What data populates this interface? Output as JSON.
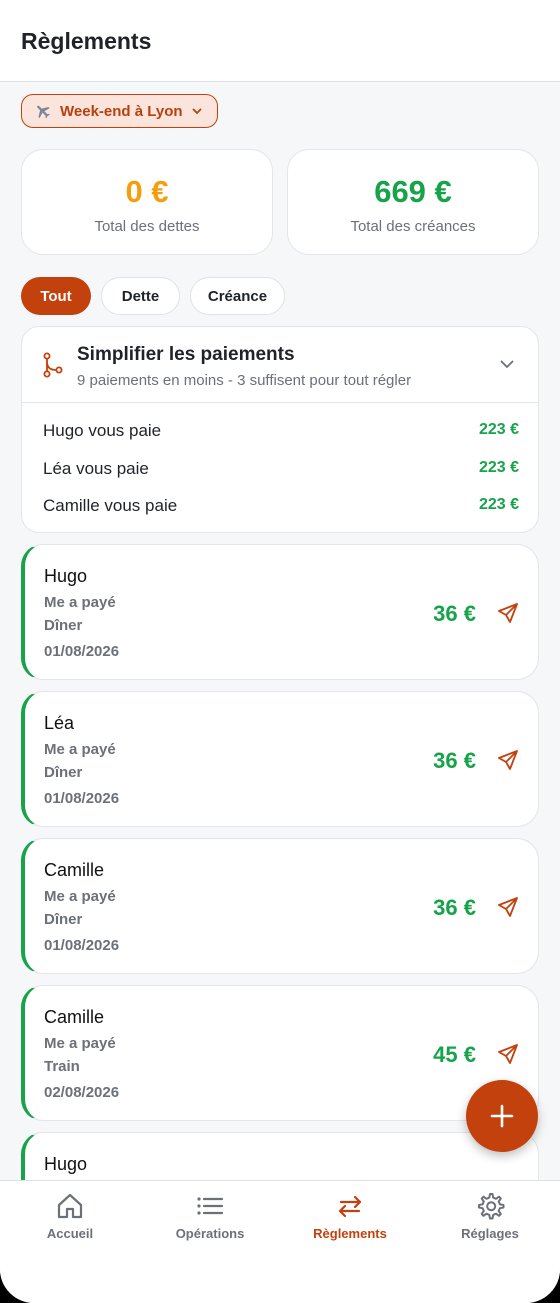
{
  "header": {
    "title": "Règlements"
  },
  "trip_selector": {
    "label": "Week-end à Lyon"
  },
  "stats": {
    "debts": {
      "amount": "0 €",
      "caption": "Total des dettes",
      "color": "#f59e0b"
    },
    "credits": {
      "amount": "669 €",
      "caption": "Total des créances",
      "color": "#16a34a"
    }
  },
  "filters": [
    {
      "label": "Tout",
      "active": true
    },
    {
      "label": "Dette",
      "active": false
    },
    {
      "label": "Créance",
      "active": false
    }
  ],
  "simplify": {
    "title": "Simplifier les paiements",
    "subtitle": "9 paiements en moins - 3 suffisent pour tout régler",
    "suggestions": [
      {
        "who": "Hugo vous paie",
        "amount": "223 €"
      },
      {
        "who": "Léa vous paie",
        "amount": "223 €"
      },
      {
        "who": "Camille vous paie",
        "amount": "223 €"
      }
    ]
  },
  "payments": [
    {
      "name": "Hugo",
      "status": "Me a payé",
      "label": "Dîner",
      "date": "01/08/2026",
      "amount": "36 €"
    },
    {
      "name": "Léa",
      "status": "Me a payé",
      "label": "Dîner",
      "date": "01/08/2026",
      "amount": "36 €"
    },
    {
      "name": "Camille",
      "status": "Me a payé",
      "label": "Dîner",
      "date": "01/08/2026",
      "amount": "36 €"
    },
    {
      "name": "Camille",
      "status": "Me a payé",
      "label": "Train",
      "date": "02/08/2026",
      "amount": "45 €"
    },
    {
      "name": "Hugo"
    }
  ],
  "tabs": [
    {
      "label": "Accueil",
      "icon": "home-icon",
      "active": false
    },
    {
      "label": "Opérations",
      "icon": "list-icon",
      "active": false
    },
    {
      "label": "Règlements",
      "icon": "transfer-icon",
      "active": true
    },
    {
      "label": "Réglages",
      "icon": "gear-icon",
      "active": false
    }
  ],
  "colors": {
    "accent": "#c2410c",
    "positive": "#16a34a",
    "warning": "#f59e0b"
  }
}
